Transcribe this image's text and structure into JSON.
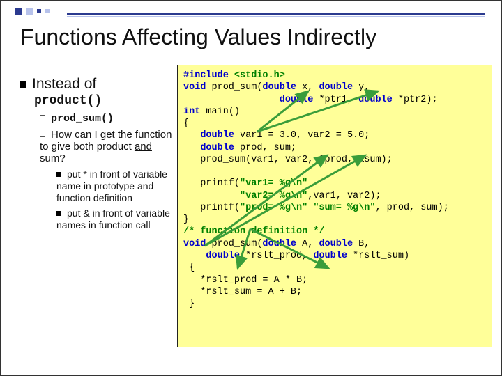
{
  "title": "Functions Affecting Values Indirectly",
  "bullets": {
    "instead_of": "Instead of",
    "product_fn": "product()",
    "prod_sum_fn": "prod_sum()",
    "how_can": "How can I get the function to give both product ",
    "and_word": "and",
    "sum_q": " sum?",
    "sub1": "put * in front of variable name in prototype and function definition",
    "sub2": "put & in front of variable names in function call"
  },
  "code": {
    "l01a": "#include",
    "l01b": " <stdio.h>",
    "l02a": "void",
    "l02b": " prod_sum(",
    "l02c": "double",
    "l02d": " x, ",
    "l02e": "double",
    "l02f": " y,",
    "l03a": "                 ",
    "l03b": "double",
    "l03c": " *ptr1, ",
    "l03d": "double",
    "l03e": " *ptr2);",
    "l04a": "int",
    "l04b": " main()",
    "l05": "{",
    "l06a": "   ",
    "l06b": "double",
    "l06c": " var1 = 3.0, var2 = 5.0;",
    "l07a": "   ",
    "l07b": "double",
    "l07c": " prod, sum;",
    "l08": "   prod_sum(var1, var2, &prod, &sum);",
    "l09": "",
    "l10a": "   printf(",
    "l10b": "\"var1= %g\\n\"",
    "l11a": "          ",
    "l11b": "\"var2= %g\\n\"",
    "l11c": ",var1, var2);",
    "l12a": "   printf(",
    "l12b": "\"prod= %g\\n\" \"sum= %g\\n\"",
    "l12c": ", prod, sum);",
    "l13": "}",
    "l14": "/* function definition */",
    "l15a": "void",
    "l15b": " prod_sum(",
    "l15c": "double",
    "l15d": " A, ",
    "l15e": "double",
    "l15f": " B,",
    "l16a": "    ",
    "l16b": "double",
    "l16c": " *rslt_prod, ",
    "l16d": "double",
    "l16e": " *rslt_sum)",
    "l17": " {",
    "l18": "   *rslt_prod = A * B;",
    "l19": "   *rslt_sum = A + B;",
    "l20": " }"
  }
}
